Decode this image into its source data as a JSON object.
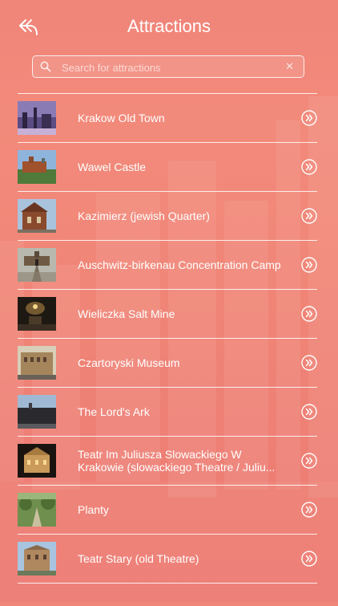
{
  "header": {
    "title": "Attractions",
    "back_icon": "back-arrow-icon"
  },
  "search": {
    "placeholder": "Search for attractions",
    "value": ""
  },
  "attractions": [
    {
      "label": "Krakow Old Town",
      "thumb_color": "#6b5c8a"
    },
    {
      "label": "Wawel Castle",
      "thumb_color": "#7a6a55"
    },
    {
      "label": "Kazimierz (jewish Quarter)",
      "thumb_color": "#8a5a3a"
    },
    {
      "label": "Auschwitz-birkenau Concentration Camp",
      "thumb_color": "#7f7a6a"
    },
    {
      "label": "Wieliczka Salt Mine",
      "thumb_color": "#3a2e24"
    },
    {
      "label": "Czartoryski Museum",
      "thumb_color": "#9a7a55"
    },
    {
      "label": "The Lord's Ark",
      "thumb_color": "#2c2c30"
    },
    {
      "label": "Teatr Im Juliusza Slowackiego W Krakowie (slowackiego Theatre / Juliu...",
      "thumb_color": "#3a2a1a"
    },
    {
      "label": "Planty",
      "thumb_color": "#5f7a45"
    },
    {
      "label": "Teatr Stary (old Theatre)",
      "thumb_color": "#8a6a4a"
    }
  ],
  "colors": {
    "background": "#f08677",
    "text": "#ffffff"
  }
}
